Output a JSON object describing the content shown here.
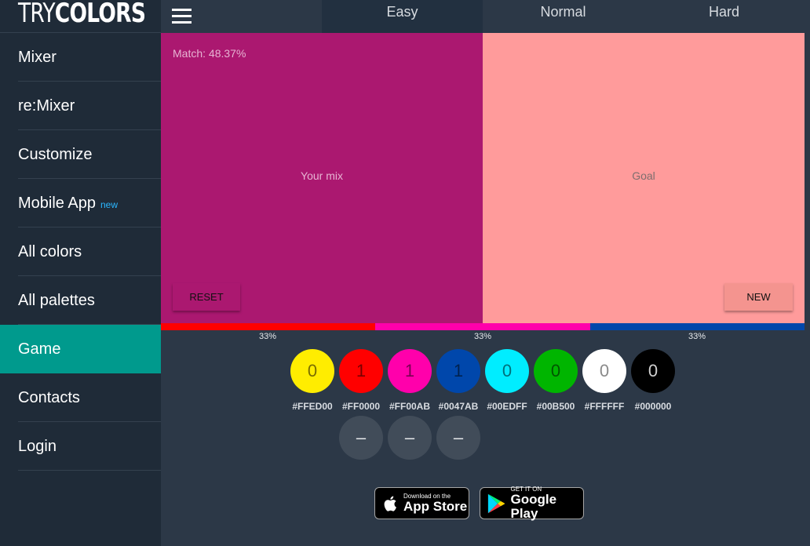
{
  "brand": {
    "logo_thin": "TRY",
    "logo_bold": "COLORS"
  },
  "sidebar": {
    "items": [
      {
        "label": "Mixer",
        "active": false
      },
      {
        "label": "re:Mixer",
        "active": false
      },
      {
        "label": "Customize",
        "active": false
      },
      {
        "label": "Mobile App",
        "badge": "new",
        "active": false
      },
      {
        "label": "All colors",
        "active": false
      },
      {
        "label": "All palettes",
        "active": false
      },
      {
        "label": "Game",
        "active": true
      },
      {
        "label": "Contacts",
        "active": false
      },
      {
        "label": "Login",
        "active": false
      }
    ]
  },
  "tabs": [
    {
      "label": "Easy",
      "active": true
    },
    {
      "label": "Normal",
      "active": false
    },
    {
      "label": "Hard",
      "active": false
    }
  ],
  "game": {
    "match_text": "Match: 48.37%",
    "your_mix_label": "Your mix",
    "goal_label": "Goal",
    "reset_label": "RESET",
    "new_label": "NEW",
    "your_mix_color": "#ab1870",
    "goal_color": "#ff9b9b",
    "reset_bg": "#ab1870",
    "new_bg": "#f4948f"
  },
  "ratio": [
    {
      "color": "#ff0000",
      "percent": "33%"
    },
    {
      "color": "#ff00ab",
      "percent": "33%"
    },
    {
      "color": "#0047ab",
      "percent": "33%"
    }
  ],
  "swatches": [
    {
      "hex": "#FFED00",
      "count": "0",
      "text_color": "#7a6e00"
    },
    {
      "hex": "#FF0000",
      "count": "1",
      "text_color": "#7a0000"
    },
    {
      "hex": "#FF00AB",
      "count": "1",
      "text_color": "#7a0052"
    },
    {
      "hex": "#0047AB",
      "count": "1",
      "text_color": "#00224f"
    },
    {
      "hex": "#00EDFF",
      "count": "0",
      "text_color": "#00707a"
    },
    {
      "hex": "#00B500",
      "count": "0",
      "text_color": "#005600"
    },
    {
      "hex": "#FFFFFF",
      "count": "0",
      "text_color": "#8a8a8a"
    },
    {
      "hex": "#000000",
      "count": "0",
      "text_color": "#d0d0d0"
    }
  ],
  "minus_buttons": [
    "–",
    "–",
    "–"
  ],
  "stores": {
    "appstore_small": "Download on the",
    "appstore_big": "App Store",
    "google_small": "GET IT ON",
    "google_big": "Google Play"
  }
}
